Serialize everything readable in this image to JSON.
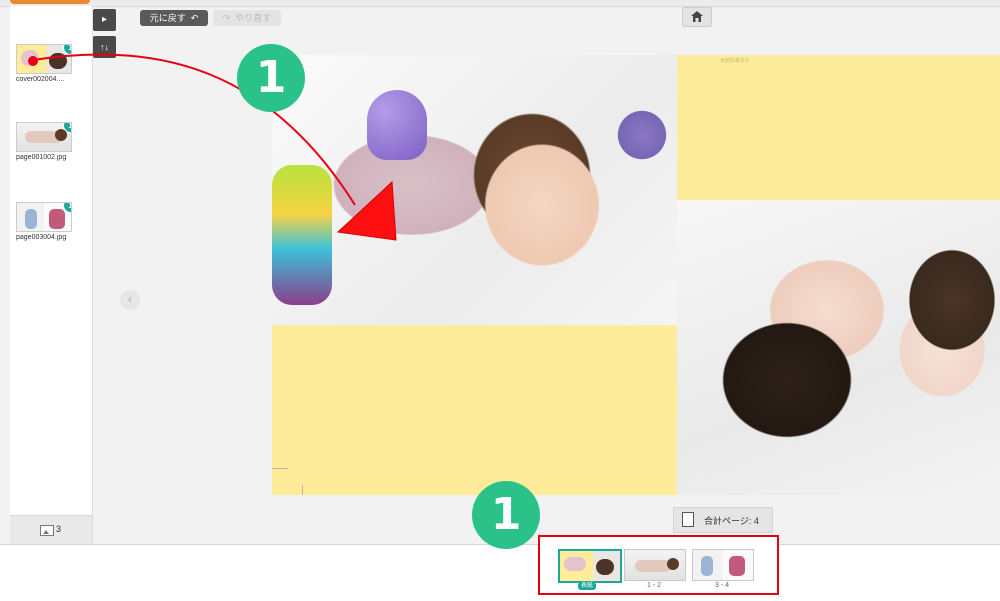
{
  "toolbar": {
    "undo_label": "元に戻す",
    "redo_label": "やり直す",
    "expand_icon": "play-icon",
    "sort_icon": "sort-icon",
    "home_icon": "home-icon"
  },
  "sidebar": {
    "items": [
      {
        "file": "cover002004....",
        "count": "1"
      },
      {
        "file": "page001002.jpg",
        "count": "1"
      },
      {
        "file": "page003004.jpg",
        "count": "1"
      }
    ],
    "photo_total": "3"
  },
  "canvas": {
    "tiny_label": "大切なあなた"
  },
  "page_count": {
    "label": "合計ページ:",
    "value": "4"
  },
  "page_nav": {
    "cover_label": "表紙",
    "pages": [
      "1 - 2",
      "3 - 4"
    ]
  },
  "markers": {
    "top": "1",
    "bottom": "1"
  },
  "colors": {
    "accent_teal": "#1aa99a",
    "marker_green": "#2bc28a",
    "highlight_red": "#e60012",
    "page_yellow": "#feec9a",
    "top_orange": "#e8892f"
  }
}
